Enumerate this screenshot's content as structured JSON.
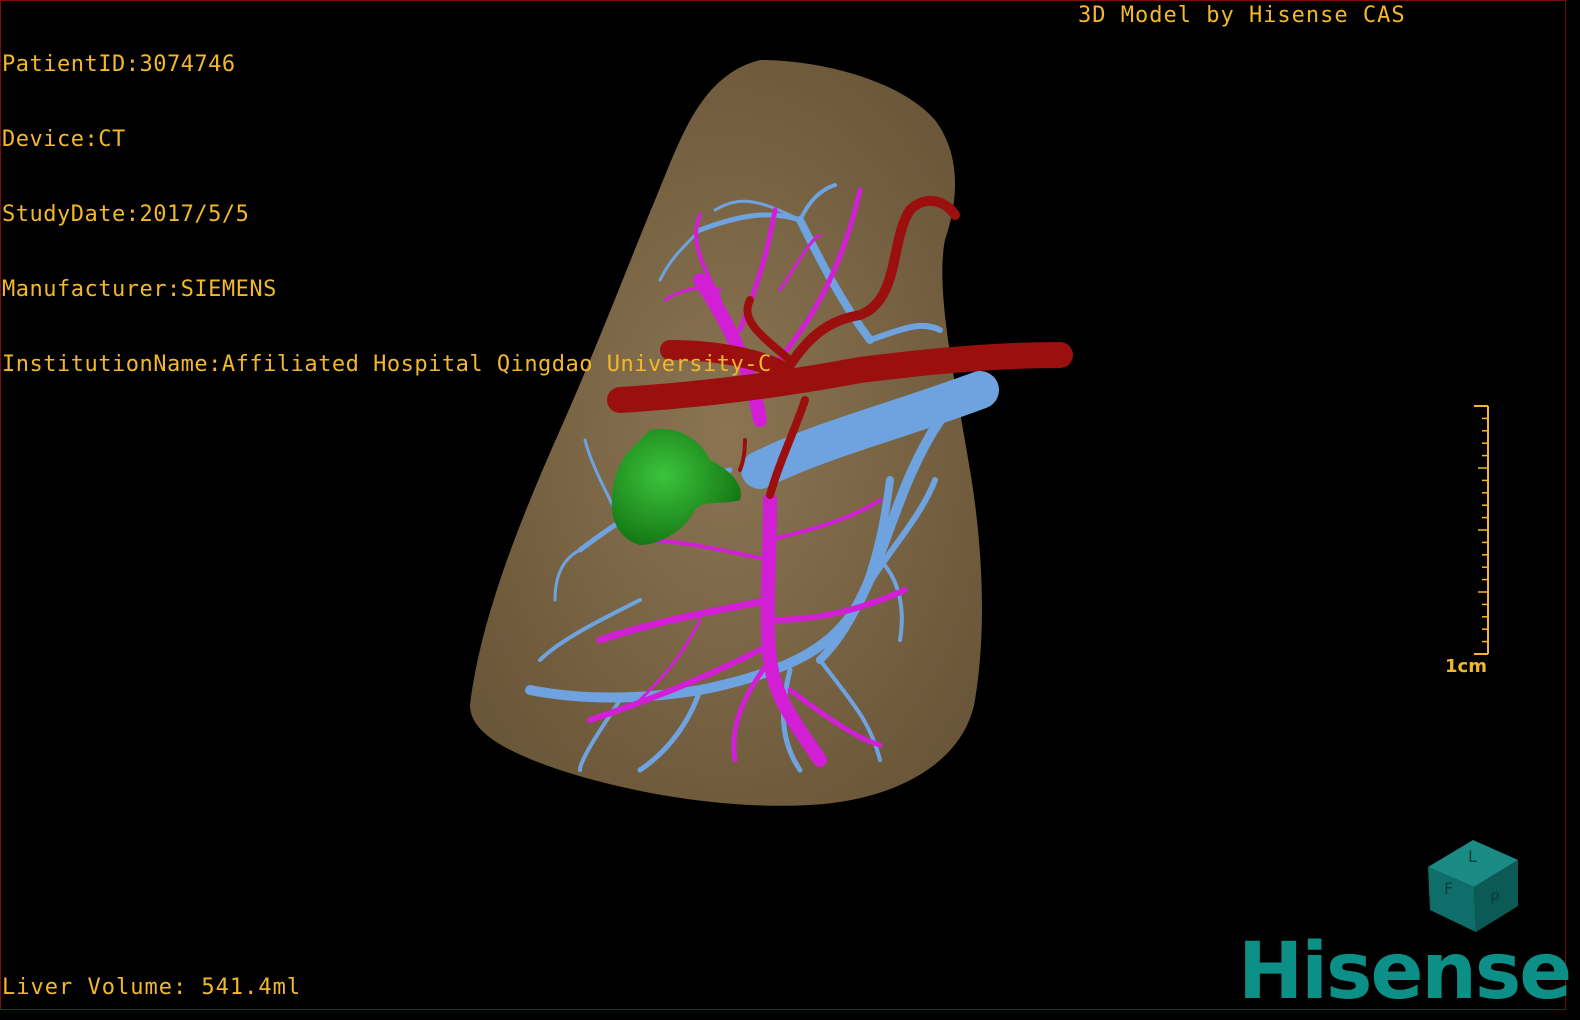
{
  "overlay": {
    "patient_id": "PatientID:3074746",
    "device": "Device:CT",
    "study_date": "StudyDate:2017/5/5",
    "manufacturer": "Manufacturer:SIEMENS",
    "institution": "InstitutionName:Affiliated Hospital Qingdao University-C",
    "credit": "3D Model by Hisense CAS",
    "liver_volume": "Liver Volume: 541.4ml"
  },
  "scale_bar": {
    "label": "1cm"
  },
  "orientation_cube": {
    "faces": [
      "F",
      "L",
      "P"
    ],
    "color": "#0f6e6a"
  },
  "logo": {
    "text": "Hisense",
    "color": "#0b8f86"
  },
  "colors": {
    "text": "#f2b82a",
    "liver": "#7a6648",
    "portal_vein": "#6fa3e0",
    "hepatic_vein": "#d21fd6",
    "artery": "#9b0f0f",
    "lesion": "#1f9e1f"
  }
}
